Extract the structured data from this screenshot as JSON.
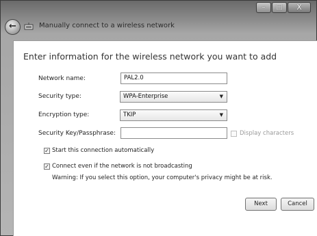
{
  "window": {
    "minimize_glyph": "–",
    "maximize_glyph": "□",
    "close_glyph": "X"
  },
  "wizard": {
    "title": "Manually connect to a wireless network",
    "back_glyph": "←",
    "heading": "Enter information for the wireless network you want to add"
  },
  "form": {
    "network_name": {
      "label": "Network name:",
      "value": "PAL2.0"
    },
    "security_type": {
      "label": "Security type:",
      "value": "WPA-Enterprise"
    },
    "encryption_type": {
      "label": "Encryption type:",
      "value": "TKIP"
    },
    "security_key": {
      "label": "Security Key/Passphrase:",
      "value": ""
    },
    "display_characters": {
      "label": "Display characters",
      "checked": false,
      "enabled": false
    },
    "start_auto": {
      "label": "Start this connection automatically",
      "checked": true
    },
    "connect_hidden": {
      "label": "Connect even if the network is not broadcasting",
      "checked": true
    },
    "warning": "Warning: If you select this option, your computer's privacy might be at risk."
  },
  "buttons": {
    "next": "Next",
    "cancel": "Cancel"
  },
  "icons": {
    "check_glyph": "✓",
    "dropdown_glyph": "▼"
  }
}
